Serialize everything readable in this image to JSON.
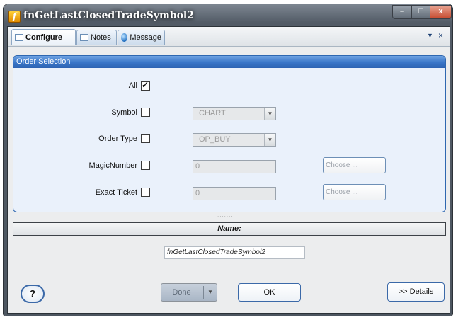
{
  "window": {
    "title": "fnGetLastClosedTradeSymbol2",
    "app_icon": "f",
    "controls": {
      "minimize": "–",
      "maximize": "□",
      "close": "x"
    }
  },
  "tabs": [
    {
      "label": "Configure",
      "icon": "grid-icon",
      "active": true
    },
    {
      "label": "Notes",
      "icon": "grid-icon",
      "active": false
    },
    {
      "label": "Message",
      "icon": "globe-icon",
      "active": false
    }
  ],
  "tab_strip": {
    "menu_glyph": "▼",
    "close_glyph": "×"
  },
  "order_selection": {
    "header": "Order Selection",
    "all": {
      "label": "All",
      "checked": true
    },
    "symbol": {
      "label": "Symbol",
      "checked": false,
      "value": "CHART"
    },
    "order_type": {
      "label": "Order Type",
      "checked": false,
      "value": "OP_BUY"
    },
    "magic_number": {
      "label": "MagicNumber",
      "checked": false,
      "value": "0",
      "choose_label": "Choose ..."
    },
    "exact_ticket": {
      "label": "Exact Ticket",
      "checked": false,
      "value": "0",
      "choose_label": "Choose ..."
    }
  },
  "splitter_grip": "::::::::",
  "name_section": {
    "header": "Name:",
    "value": "fnGetLastClosedTradeSymbol2"
  },
  "buttons": {
    "help": "?",
    "done": "Done",
    "done_arrow": "▼",
    "ok": "OK",
    "details": ">> Details"
  },
  "colors": {
    "accent": "#3a76c8",
    "panel": "#eaf1fb",
    "chrome": "#525b66",
    "close": "#c64b2f"
  }
}
